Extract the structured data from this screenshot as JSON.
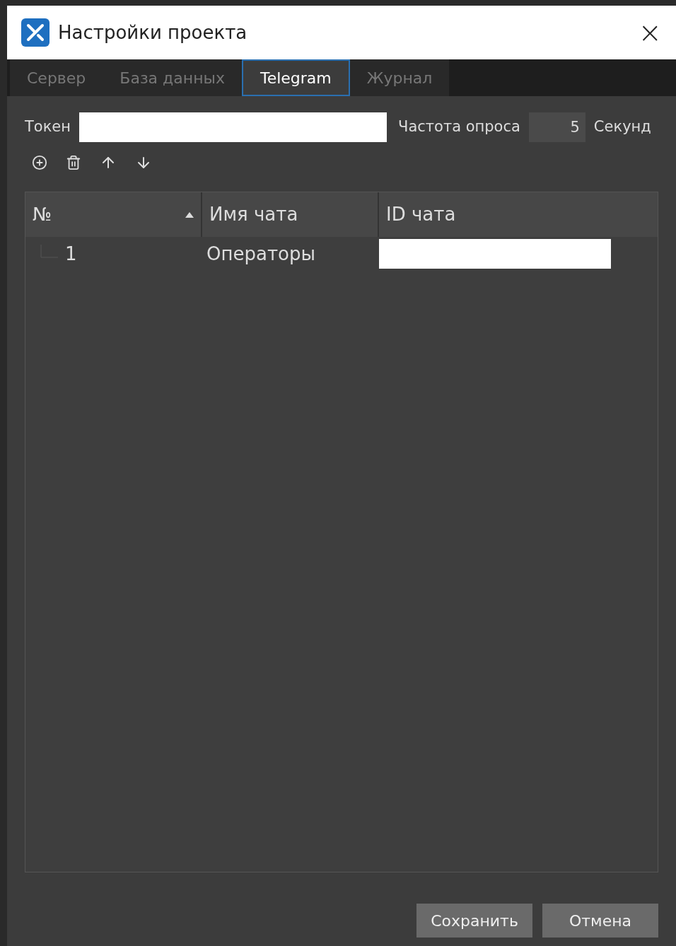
{
  "window": {
    "title": "Настройки проекта",
    "close": "×"
  },
  "tabs": [
    {
      "label": "Сервер",
      "selected": false
    },
    {
      "label": "База данных",
      "selected": false
    },
    {
      "label": "Telegram",
      "selected": true
    },
    {
      "label": "Журнал",
      "selected": false
    }
  ],
  "token": {
    "label": "Токен"
  },
  "poll": {
    "label": "Частота опроса",
    "value": "5",
    "unit": "Секунд"
  },
  "table": {
    "columns": [
      {
        "label": "№",
        "sorted": true
      },
      {
        "label": "Имя чата",
        "sorted": false
      },
      {
        "label": "ID чата",
        "sorted": false
      }
    ],
    "rows": [
      {
        "number": "1",
        "name": "Операторы"
      }
    ]
  },
  "buttons": [
    "Сохранить",
    "Отмена"
  ]
}
